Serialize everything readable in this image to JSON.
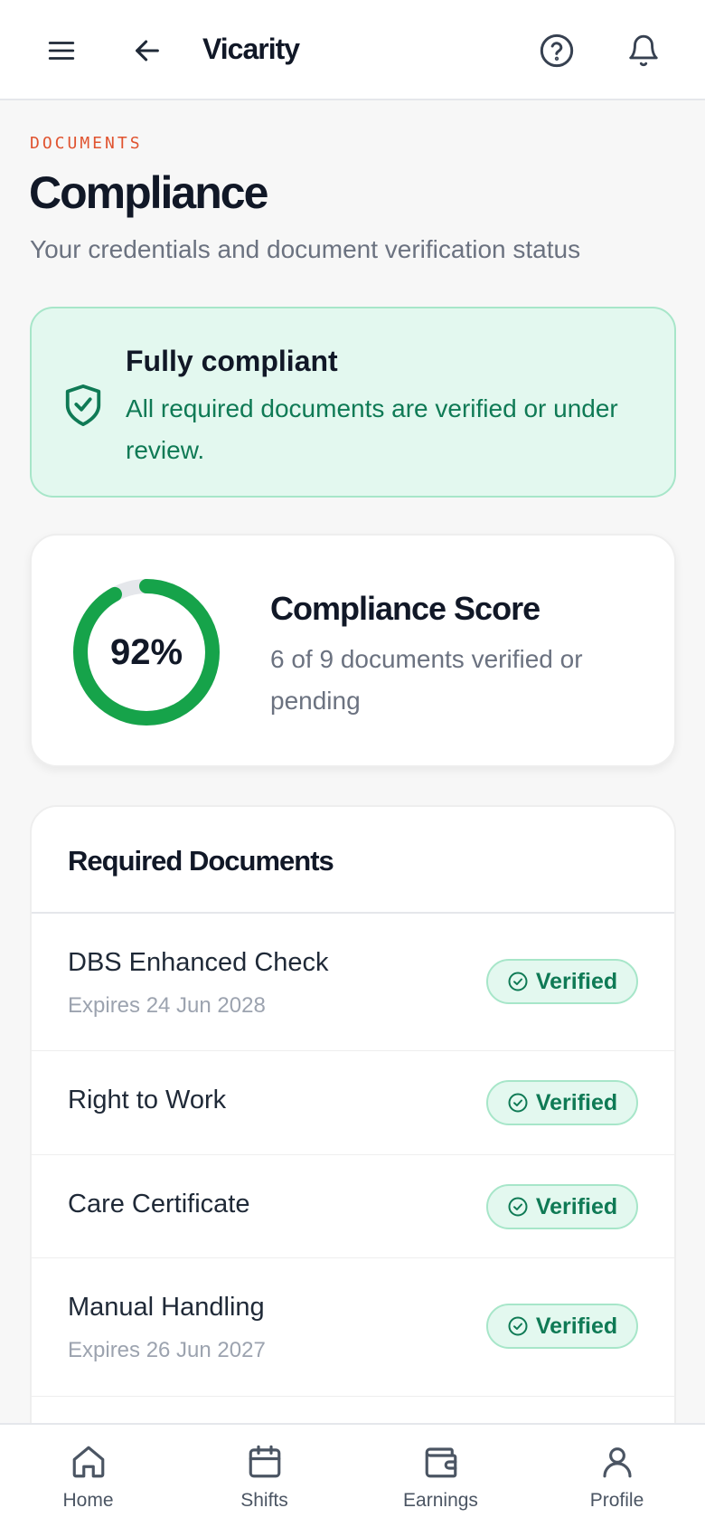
{
  "topbar": {
    "app_title": "Vicarity",
    "icons": [
      "menu-icon",
      "back-arrow-icon",
      "help-circle-icon",
      "bell-icon"
    ]
  },
  "header": {
    "eyebrow": "DOCUMENTS",
    "title": "Compliance",
    "subtitle": "Your credentials and document verification status"
  },
  "banner": {
    "icon": "shield-check-icon",
    "title": "Fully compliant",
    "text": "All required documents are verified or under review."
  },
  "score": {
    "percent_label": "92%",
    "progress": 0.92,
    "title": "Compliance Score",
    "text": "6 of 9 documents verified or pending"
  },
  "documents": {
    "title": "Required Documents",
    "items": [
      {
        "name": "DBS Enhanced Check",
        "sub": "Expires 24 Jun 2028",
        "status": "Verified"
      },
      {
        "name": "Right to Work",
        "sub": "",
        "status": "Verified"
      },
      {
        "name": "Care Certificate",
        "sub": "",
        "status": "Verified"
      },
      {
        "name": "Manual Handling",
        "sub": "Expires 26 Jun 2027",
        "status": "Verified"
      }
    ]
  },
  "nav": {
    "items": [
      {
        "label": "Home",
        "icon": "home-icon"
      },
      {
        "label": "Shifts",
        "icon": "calendar-icon"
      },
      {
        "label": "Earnings",
        "icon": "wallet-icon"
      },
      {
        "label": "Profile",
        "icon": "user-icon"
      }
    ]
  },
  "colors": {
    "accent_orange": "#e0532f",
    "success_green": "#16a34a",
    "success_text": "#0f7a55",
    "success_bg": "#e3f8ef",
    "ink": "#111827"
  }
}
